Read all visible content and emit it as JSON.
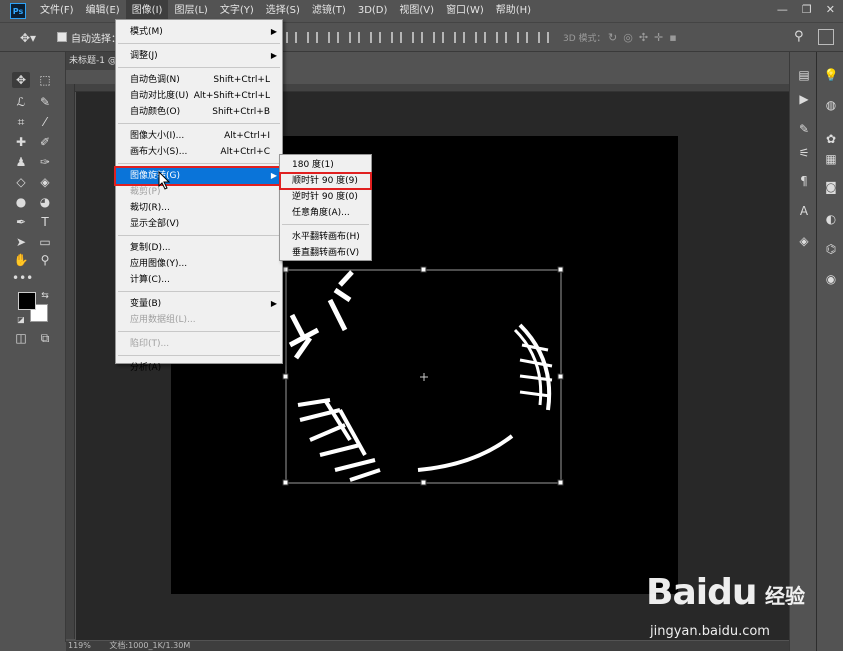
{
  "menubar": {
    "logo": "Ps",
    "items": [
      "文件(F)",
      "编辑(E)",
      "图像(I)",
      "图层(L)",
      "文字(Y)",
      "选择(S)",
      "滤镜(T)",
      "3D(D)",
      "视图(V)",
      "窗口(W)",
      "帮助(H)"
    ],
    "active_index": 2,
    "window_controls": [
      "—",
      "❐",
      "✕"
    ]
  },
  "options_bar": {
    "auto_select_label": "自动选择：",
    "mode_3d_label": "3D 模式："
  },
  "document": {
    "tab_title": "未标题-1 @",
    "zoom": "119%",
    "doc_info": "文档:1000_1K/1.30M"
  },
  "image_menu": {
    "items": [
      {
        "label": "模式(M)",
        "shortcut": "",
        "submenu": true,
        "disabled": false
      },
      {
        "label": "调整(J)",
        "shortcut": "",
        "submenu": true,
        "disabled": false
      },
      {
        "label": "自动色调(N)",
        "shortcut": "Shift+Ctrl+L",
        "submenu": false,
        "disabled": false
      },
      {
        "label": "自动对比度(U)",
        "shortcut": "Alt+Shift+Ctrl+L",
        "submenu": false,
        "disabled": false
      },
      {
        "label": "自动颜色(O)",
        "shortcut": "Shift+Ctrl+B",
        "submenu": false,
        "disabled": false
      },
      {
        "label": "图像大小(I)...",
        "shortcut": "Alt+Ctrl+I",
        "submenu": false,
        "disabled": false
      },
      {
        "label": "画布大小(S)...",
        "shortcut": "Alt+Ctrl+C",
        "submenu": false,
        "disabled": false
      },
      {
        "label": "图像旋转(G)",
        "shortcut": "",
        "submenu": true,
        "disabled": false
      },
      {
        "label": "裁剪(P)",
        "shortcut": "",
        "submenu": false,
        "disabled": true
      },
      {
        "label": "裁切(R)...",
        "shortcut": "",
        "submenu": false,
        "disabled": false
      },
      {
        "label": "显示全部(V)",
        "shortcut": "",
        "submenu": false,
        "disabled": false
      },
      {
        "label": "复制(D)...",
        "shortcut": "",
        "submenu": false,
        "disabled": false
      },
      {
        "label": "应用图像(Y)...",
        "shortcut": "",
        "submenu": false,
        "disabled": false
      },
      {
        "label": "计算(C)...",
        "shortcut": "",
        "submenu": false,
        "disabled": false
      },
      {
        "label": "变量(B)",
        "shortcut": "",
        "submenu": true,
        "disabled": false
      },
      {
        "label": "应用数据组(L)...",
        "shortcut": "",
        "submenu": false,
        "disabled": true
      },
      {
        "label": "陷印(T)...",
        "shortcut": "",
        "submenu": false,
        "disabled": true
      },
      {
        "label": "分析(A)",
        "shortcut": "",
        "submenu": true,
        "disabled": false
      }
    ],
    "highlighted_index": 7
  },
  "rotate_submenu": {
    "items": [
      "180 度(1)",
      "顺时针 90 度(9)",
      "逆时针 90 度(0)",
      "任意角度(A)...",
      "水平翻转画布(H)",
      "垂直翻转画布(V)"
    ],
    "highlighted_index": 1
  },
  "watermark": {
    "brand": "Baidu",
    "product": "经验",
    "url": "jingyan.baidu.com"
  },
  "colors": {
    "ui_bg": "#535353",
    "pasteboard": "#282828",
    "menu_highlight": "#0a74d9",
    "annotation_red": "#e02020",
    "foreground_color": "#000000",
    "background_color": "#ffffff"
  }
}
